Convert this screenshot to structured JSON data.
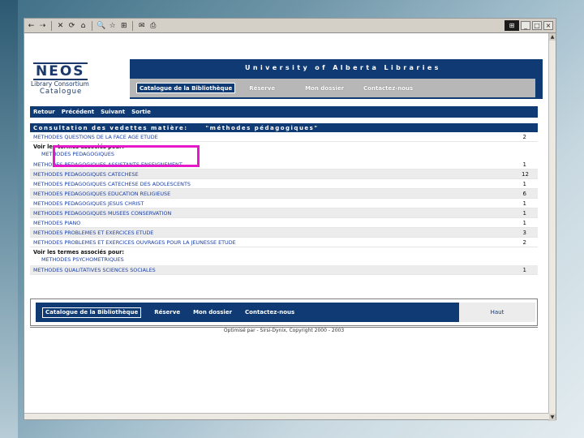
{
  "toolbar": {
    "buttons": [
      "←",
      "⇢",
      "✕",
      "⟳",
      "⌂",
      "🔍",
      "☆",
      "⊞",
      "✉",
      "⎙"
    ]
  },
  "header": {
    "logo_title": "NEOS",
    "logo_line1": "Library Consortium",
    "logo_line2": "Catalogue",
    "university": "University of Alberta Libraries",
    "nav_active": "Catalogue de la Bibliothèque",
    "nav_items": [
      "Réserve",
      "Mon dossier",
      "Contactez-nous"
    ]
  },
  "actions": [
    "Retour",
    "Précédent",
    "Suivant",
    "Sortie"
  ],
  "results": {
    "title": "Consultation des vedettes matière:",
    "query": "\"méthodes pédagogiques\"",
    "first_row": {
      "label": "METHODES QUESTIONS DE LA FACE AGE ETUDE",
      "count": "2"
    },
    "see_block_1": {
      "heading": "Voir les termes associés pour:",
      "term": "METHODES PEDAGOGIQUES"
    },
    "rows": [
      {
        "label": "METHODES PEDAGOGIQUES ASSISTANTS ENSEIGNEMENT",
        "count": "1"
      },
      {
        "label": "METHODES PEDAGOGIQUES CATECHESE",
        "count": "12"
      },
      {
        "label": "METHODES PEDAGOGIQUES CATECHESE DES ADOLESCENTS",
        "count": "1"
      },
      {
        "label": "METHODES PEDAGOGIQUES EDUCATION RELIGIEUSE",
        "count": "6"
      },
      {
        "label": "METHODES PEDAGOGIQUES JESUS CHRIST",
        "count": "1"
      },
      {
        "label": "METHODES PEDAGOGIQUES MUSEES CONSERVATION",
        "count": "1"
      },
      {
        "label": "METHODES PIANO",
        "count": "1"
      },
      {
        "label": "METHODES PROBLEMES ET EXERCICES ETUDE",
        "count": "3"
      },
      {
        "label": "METHODES PROBLEMES ET EXERCICES OUVRAGES POUR LA JEUNESSE ETUDE",
        "count": "2"
      }
    ],
    "see_block_2": {
      "heading": "Voir les termes associés pour:",
      "term": "METHODES PSYCHOMETRIQUES"
    },
    "last_row": {
      "label": "METHODES QUALITATIVES SCIENCES SOCIALES",
      "count": "1"
    }
  },
  "footer": {
    "nav_active": "Catalogue de la Bibliothèque",
    "nav_items": [
      "Réserve",
      "Mon dossier",
      "Contactez-nous"
    ],
    "top_link": "Haut",
    "copyright": "Optimisé par - Sirsi-Dynix, Copyright 2000 - 2003"
  }
}
